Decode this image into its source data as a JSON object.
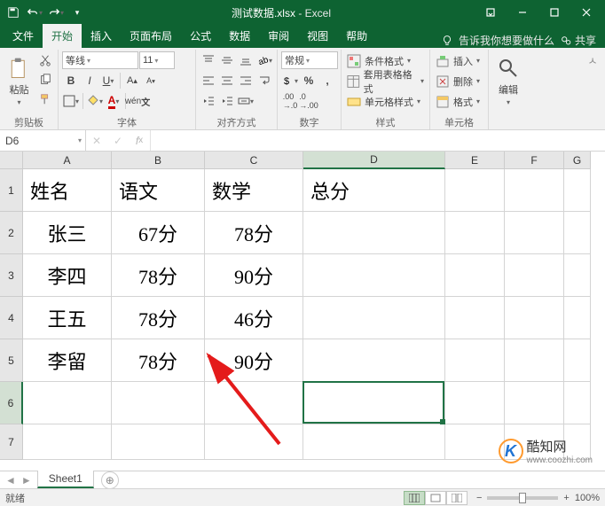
{
  "titlebar": {
    "filename": "测试数据.xlsx",
    "app": "Excel"
  },
  "tabs": {
    "items": [
      "文件",
      "开始",
      "插入",
      "页面布局",
      "公式",
      "数据",
      "审阅",
      "视图",
      "帮助"
    ],
    "active": 1,
    "tell_me": "告诉我你想要做什么",
    "share": "共享"
  },
  "ribbon": {
    "clipboard": {
      "paste": "粘贴",
      "label": "剪贴板"
    },
    "font": {
      "name": "等线",
      "size": "11",
      "label": "字体"
    },
    "align": {
      "label": "对齐方式"
    },
    "number": {
      "format": "常规",
      "label": "数字"
    },
    "styles": {
      "cond": "条件格式",
      "table": "套用表格格式",
      "cell": "单元格样式",
      "label": "样式"
    },
    "cells": {
      "insert": "插入",
      "delete": "删除",
      "format": "格式",
      "label": "单元格"
    },
    "editing": {
      "label": "编辑"
    }
  },
  "namebox": "D6",
  "formula": "",
  "columns": [
    "A",
    "B",
    "C",
    "D",
    "E",
    "F",
    "G"
  ],
  "col_widths": {
    "A": 100,
    "B": 105,
    "C": 111,
    "D": 160,
    "E": 67,
    "F": 67,
    "G": 30
  },
  "rows": [
    1,
    2,
    3,
    4,
    5,
    6,
    7
  ],
  "row_heights": {
    "1": 48,
    "2": 48,
    "3": 48,
    "4": 48,
    "5": 48,
    "6": 48,
    "7": 40
  },
  "selected": {
    "col": "D",
    "row": 6
  },
  "sheet_data": {
    "A1": "姓名",
    "B1": "语文",
    "C1": "数学",
    "D1": "总分",
    "A2": "张三",
    "B2": "67分",
    "C2": "78分",
    "A3": "李四",
    "B3": "78分",
    "C3": "90分",
    "A4": "王五",
    "B4": "78分",
    "C4": "46分",
    "A5": "李留",
    "B5": "78分",
    "C5": "90分"
  },
  "sheet_tabs": {
    "active": "Sheet1"
  },
  "status": {
    "ready": "就绪",
    "zoom": "100%"
  },
  "watermark": {
    "brand": "酷知网",
    "url": "www.coozhi.com"
  }
}
